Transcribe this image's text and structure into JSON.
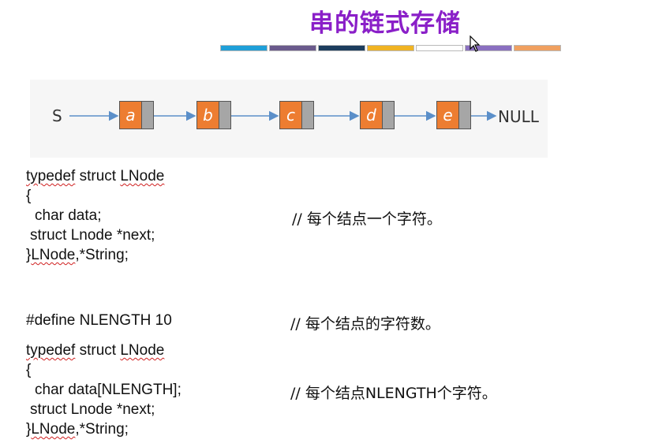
{
  "title": "串的链式存储",
  "color_bar": {
    "colors": [
      "#1f9fd8",
      "#6a5a8c",
      "#1c3d5e",
      "#f0b323",
      "#ffffff",
      "#8a6fc0",
      "#f0a060"
    ]
  },
  "diagram": {
    "head_label": "S",
    "nodes": [
      "a",
      "b",
      "c",
      "d",
      "e"
    ],
    "null_label": "NULL",
    "node_color": "#ed7d31",
    "pointer_color": "#a6a6a6",
    "arrow_color": "#5b8fc9"
  },
  "code1": {
    "line1_a": "typedef",
    "line1_b": " struct ",
    "line1_c": "LNode",
    "line2": "{",
    "line3": "char data;",
    "line4": "struct Lnode *next;",
    "line5_a": "}",
    "line5_b": "LNode",
    "line5_c": ",*String;",
    "comment": "// 每个结点一个字符。"
  },
  "define": {
    "line": "#define NLENGTH 10",
    "comment": "// 每个结点的字符数。"
  },
  "code2": {
    "line1_a": "typedef",
    "line1_b": " struct ",
    "line1_c": "LNode",
    "line2": "{",
    "line3": "char data[NLENGTH];",
    "line4": "struct Lnode *next;",
    "line5_a": "}",
    "line5_b": "LNode",
    "line5_c": ",*String;",
    "comment": "// 每个结点NLENGTH个字符。"
  }
}
